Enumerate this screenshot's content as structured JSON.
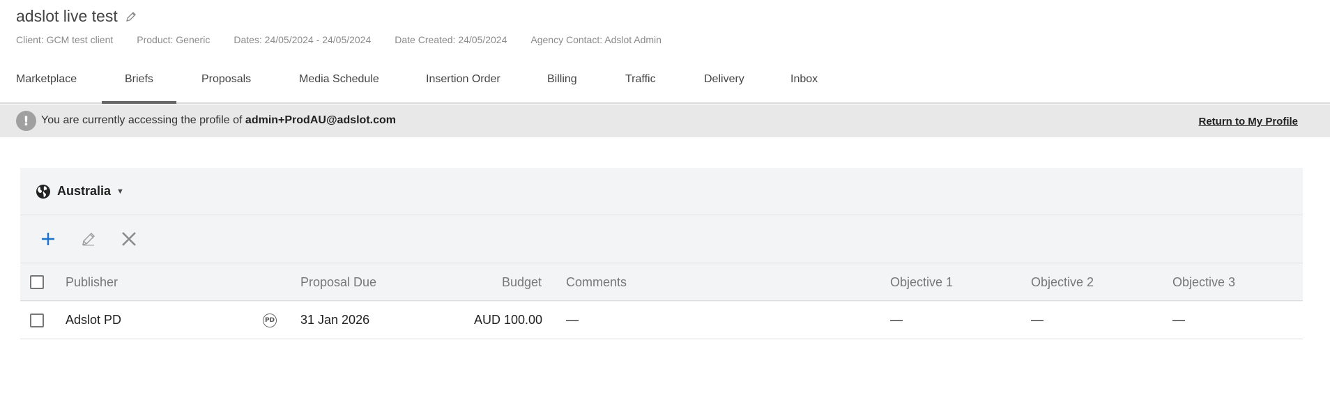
{
  "header": {
    "title": "adslot live test",
    "client": "Client: GCM test client",
    "product": "Product: Generic",
    "dates": "Dates: 24/05/2024 - 24/05/2024",
    "date_created": "Date Created: 24/05/2024",
    "agency_contact": "Agency Contact: Adslot Admin"
  },
  "tabs": [
    {
      "label": "Marketplace",
      "active": false
    },
    {
      "label": "Briefs",
      "active": true
    },
    {
      "label": "Proposals",
      "active": false
    },
    {
      "label": "Media Schedule",
      "active": false
    },
    {
      "label": "Insertion Order",
      "active": false
    },
    {
      "label": "Billing",
      "active": false
    },
    {
      "label": "Traffic",
      "active": false
    },
    {
      "label": "Delivery",
      "active": false
    },
    {
      "label": "Inbox",
      "active": false
    }
  ],
  "banner": {
    "icon": "exclamation-icon",
    "text": "You are currently accessing the profile of",
    "email": "admin+ProdAU@adslot.com",
    "return_link": "Return to My Profile"
  },
  "region": {
    "label": "Australia",
    "icon": "globe-icon"
  },
  "toolbar": {
    "add_icon": "plus-icon",
    "edit_icon": "pencil-icon",
    "delete_icon": "close-icon"
  },
  "table": {
    "columns": [
      "Publisher",
      "Proposal Due",
      "Budget",
      "Comments",
      "Objective 1",
      "Objective 2",
      "Objective 3"
    ],
    "rows": [
      {
        "publisher": "Adslot PD",
        "badge": "PD",
        "proposal_due": "31 Jan 2026",
        "budget": "AUD 100.00",
        "comments": "—",
        "objective_1": "—",
        "objective_2": "—",
        "objective_3": "—"
      }
    ]
  },
  "colors": {
    "accent": "#1a73c8",
    "banner_bg": "#e8e8e8",
    "panel_bg": "#f3f4f5",
    "active_tab_underline": "#666666"
  }
}
